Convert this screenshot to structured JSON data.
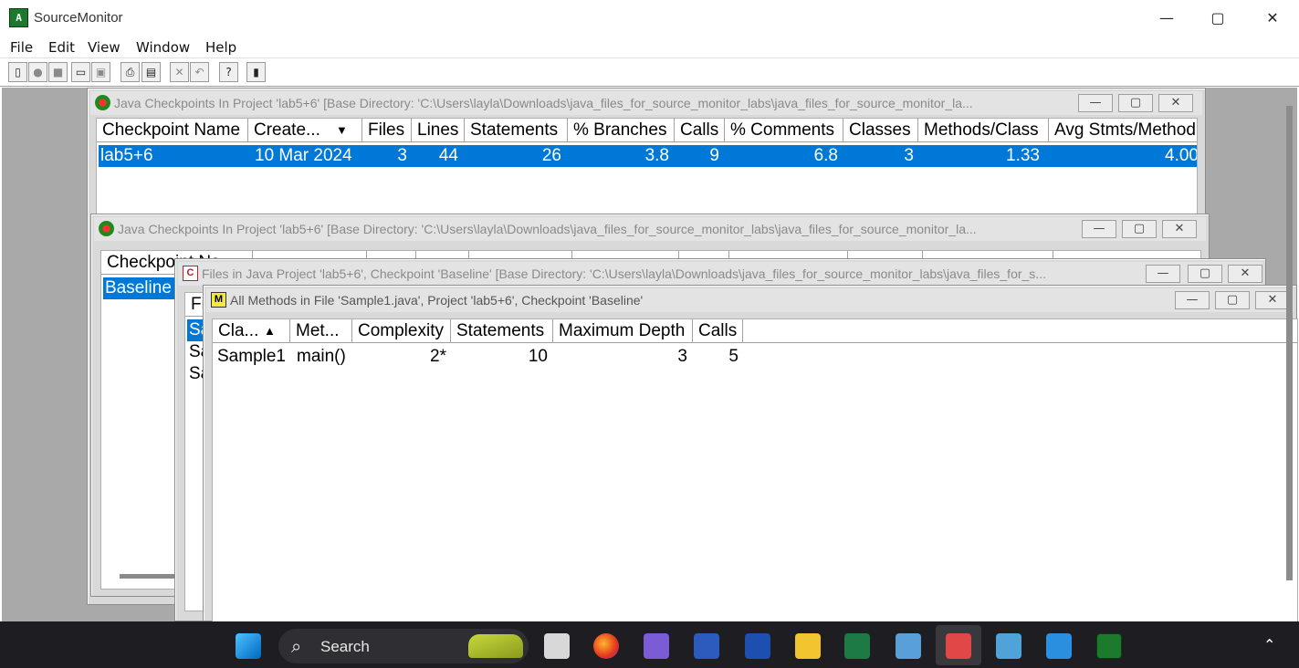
{
  "app": {
    "title": "SourceMonitor",
    "icon": "sourcemonitor-app-icon",
    "window_controls": [
      "minimize",
      "maximize",
      "close"
    ]
  },
  "menu": [
    "File",
    "Edit",
    "View",
    "Window",
    "Help"
  ],
  "toolbar": {
    "buttons": [
      "new-project",
      "open-checkpoint",
      "add-checkpoint",
      "open-project",
      "save",
      "print",
      "print-preview",
      "delete",
      "undo",
      "help-what",
      "export"
    ]
  },
  "windows": {
    "checkpoints_back": {
      "title": "Java Checkpoints In Project 'lab5+6'  [Base Directory: 'C:\\Users\\layla\\Downloads\\java_files_for_source_monitor_labs\\java_files_for_source_monitor_la...",
      "columns": [
        "Checkpoint Name",
        "Create...",
        "Files",
        "Lines",
        "Statements",
        "% Branches",
        "Calls",
        "% Comments",
        "Classes",
        "Methods/Class",
        "Avg Stmts/Method"
      ],
      "rows": [
        [
          "lab5+6",
          "10 Mar 2024",
          "3",
          "44",
          "26",
          "3.8",
          "9",
          "6.8",
          "3",
          "1.33",
          "4.00"
        ]
      ]
    },
    "checkpoints_front": {
      "title": "Java Checkpoints In Project 'lab5+6'  [Base Directory: 'C:\\Users\\layla\\Downloads\\java_files_for_source_monitor_labs\\java_files_for_source_monitor_la...",
      "columns_partial": [
        "Checkpoint Na"
      ],
      "rows": [
        [
          "Baseline"
        ]
      ]
    },
    "files": {
      "title": "Files in Java Project 'lab5+6', Checkpoint 'Baseline'  [Base Directory: 'C:\\Users\\layla\\Downloads\\java_files_for_source_monitor_labs\\java_files_for_s...",
      "columns_partial": [
        "Fi"
      ],
      "rows_partial": [
        "Sa",
        "Sa",
        "Sa"
      ]
    },
    "methods": {
      "title": "All Methods in File 'Sample1.java',  Project 'lab5+6', Checkpoint 'Baseline'",
      "columns": [
        "Cla...",
        "Met...",
        "Complexity",
        "Statements",
        "Maximum Depth",
        "Calls"
      ],
      "rows": [
        [
          "Sample1",
          "main()",
          "2*",
          "10",
          "3",
          "5"
        ]
      ]
    }
  },
  "taskbar": {
    "search_label": "Search",
    "apps": [
      "start",
      "task-view",
      "firefox",
      "bird-app",
      "word",
      "whiteboard",
      "file-explorer",
      "project",
      "3d-app",
      "snipping-tool",
      "control-panel",
      "vscode",
      "sourcemonitor"
    ]
  },
  "colors": {
    "selection": "#0078d7",
    "workspace": "#a9a9a9",
    "taskbar": "#1e1e22"
  }
}
